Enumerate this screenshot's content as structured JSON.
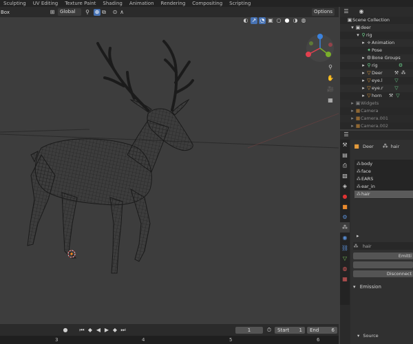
{
  "tabs": [
    "Sculpting",
    "UV Editing",
    "Texture Paint",
    "Shading",
    "Animation",
    "Rendering",
    "Compositing",
    "Scripting"
  ],
  "header": {
    "select_mode": "Box",
    "orientation": "Global",
    "options_label": "Options"
  },
  "timeline": {
    "current_frame": "1",
    "start_label": "Start",
    "start_value": "1",
    "end_label": "End",
    "end_value": "6"
  },
  "ruler": [
    "3",
    "4",
    "5",
    "6"
  ],
  "outliner": {
    "items": [
      {
        "label": "Scene Collection",
        "icon": "collection-icon"
      },
      {
        "label": "deer",
        "icon": "collection-icon"
      },
      {
        "label": "rig",
        "icon": "armature-icon"
      },
      {
        "label": "Animation",
        "icon": "animation-icon"
      },
      {
        "label": "Pose",
        "icon": "pose-icon"
      },
      {
        "label": "Bone Groups",
        "icon": "bone-groups-icon"
      },
      {
        "label": "rig",
        "icon": "armature-data-icon"
      },
      {
        "label": "Deer",
        "icon": "mesh-icon"
      },
      {
        "label": "eye.l",
        "icon": "mesh-icon"
      },
      {
        "label": "eye.r",
        "icon": "mesh-icon"
      },
      {
        "label": "horn",
        "icon": "mesh-icon"
      },
      {
        "label": "Widgets",
        "icon": "collection-icon"
      },
      {
        "label": "Camera",
        "icon": "camera-icon"
      },
      {
        "label": "Camera.001",
        "icon": "camera-icon"
      },
      {
        "label": "Camera.002",
        "icon": "camera-icon"
      }
    ]
  },
  "properties": {
    "object_name": "Deer",
    "group_name": "hair",
    "vertex_groups": [
      "body",
      "face",
      "EARS",
      "ear_in",
      "hair"
    ],
    "selected_group": "hair",
    "search_value": "hair",
    "emit_label": "Emitti",
    "disconnect_label": "Disconnect",
    "emission_label": "Emission",
    "source_label": "Source"
  }
}
